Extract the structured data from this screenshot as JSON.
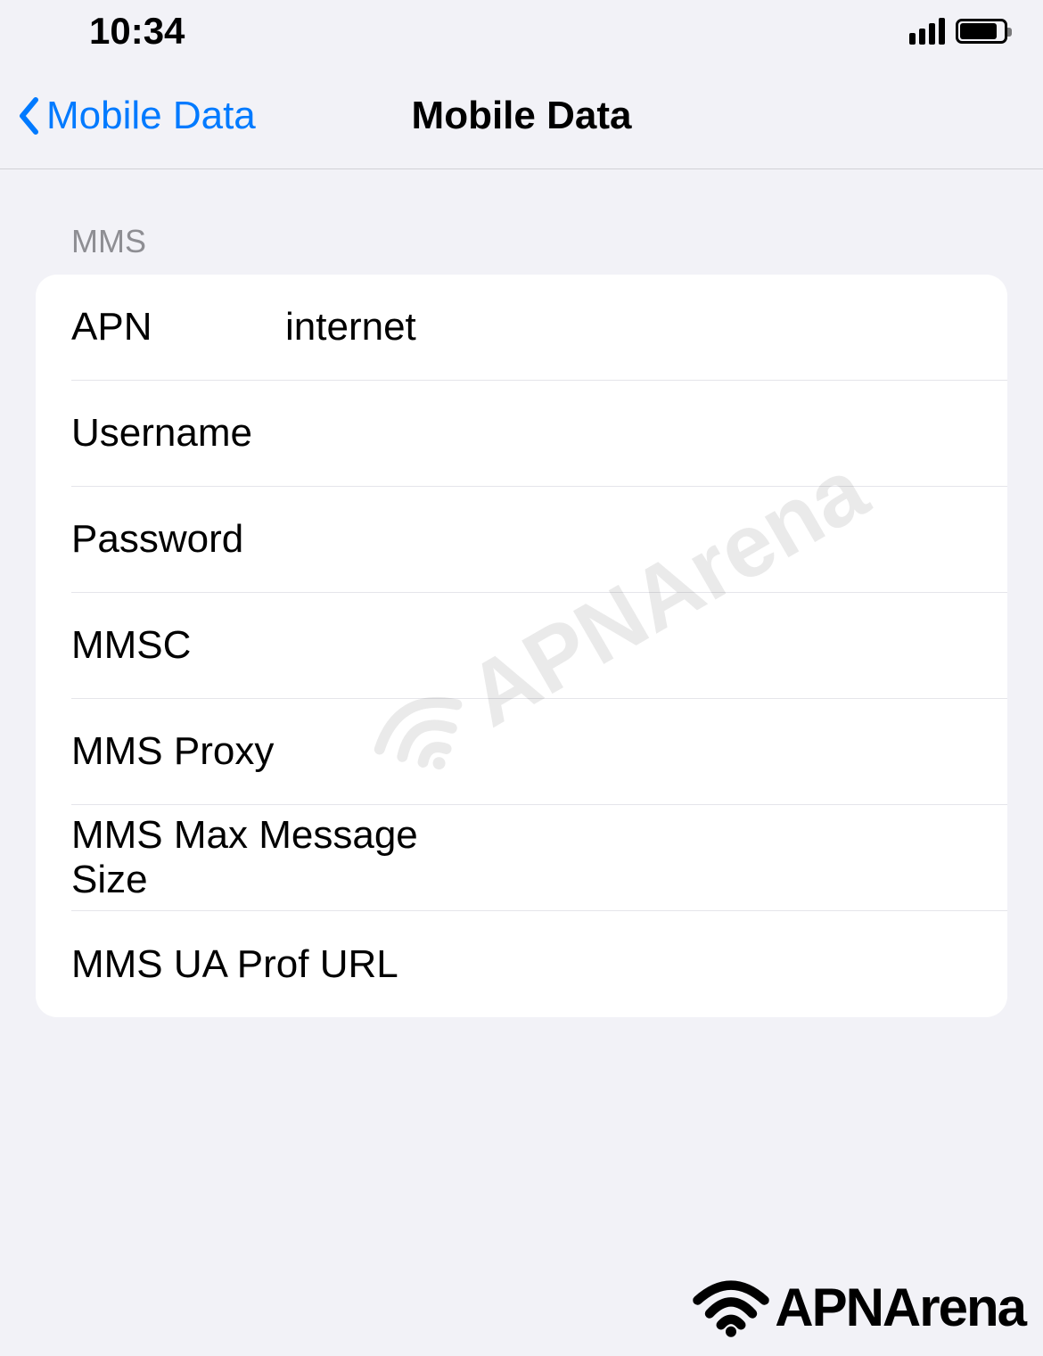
{
  "status": {
    "time": "10:34"
  },
  "nav": {
    "back_label": "Mobile Data",
    "title": "Mobile Data"
  },
  "section": {
    "header": "MMS"
  },
  "fields": {
    "apn": {
      "label": "APN",
      "value": "internet"
    },
    "username": {
      "label": "Username",
      "value": ""
    },
    "password": {
      "label": "Password",
      "value": ""
    },
    "mmsc": {
      "label": "MMSC",
      "value": ""
    },
    "mms_proxy": {
      "label": "MMS Proxy",
      "value": ""
    },
    "mms_max_size": {
      "label": "MMS Max Message Size",
      "value": ""
    },
    "mms_ua_prof": {
      "label": "MMS UA Prof URL",
      "value": ""
    }
  },
  "watermark": {
    "text": "APNArena"
  }
}
